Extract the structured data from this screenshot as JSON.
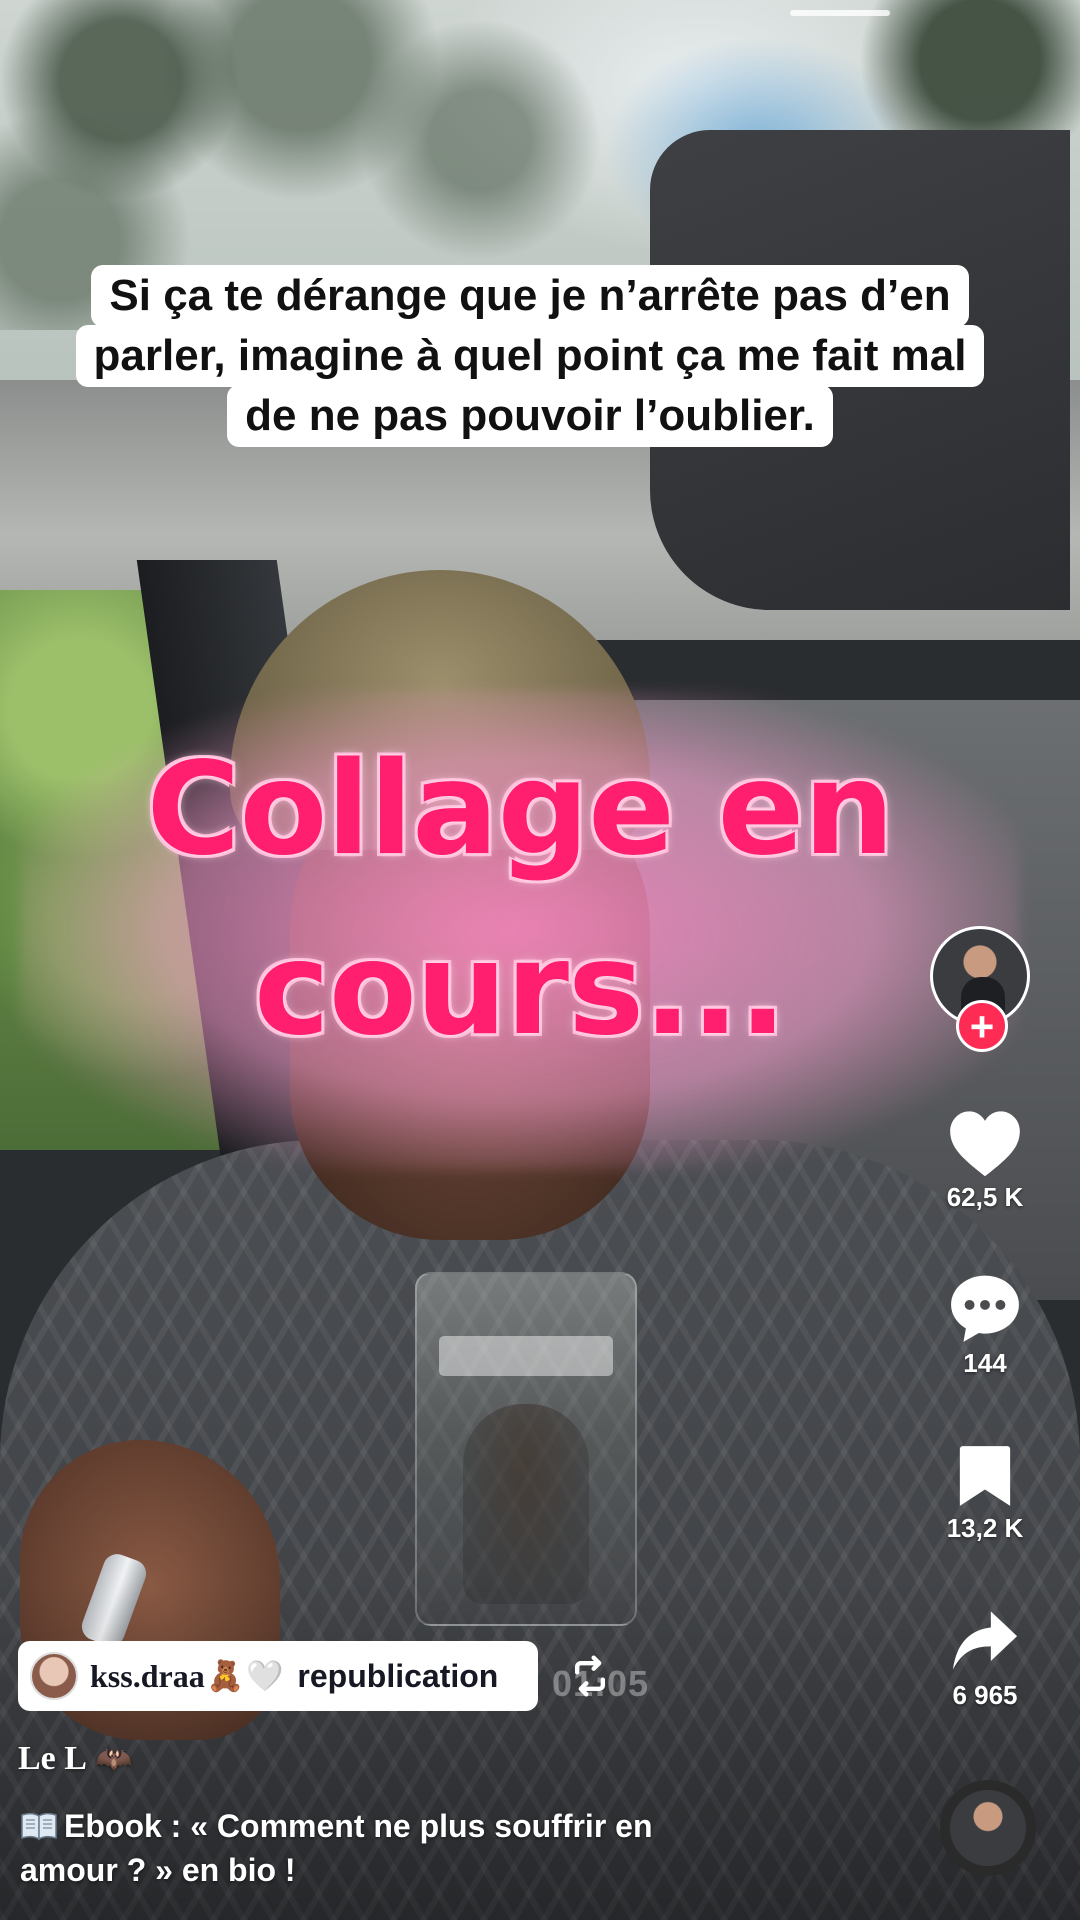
{
  "caption": {
    "lines": [
      "Si ça te dérange que je n’arrête pas d’en",
      "parler, imagine à quel point ça me fait mal",
      "de ne pas pouvoir l’oublier."
    ]
  },
  "collage": {
    "line1": "Collage en",
    "line2": "cours..."
  },
  "actions": {
    "likes": "62,5 K",
    "comments": "144",
    "saves": "13,2 K",
    "shares": "6 965"
  },
  "repost": {
    "username": "kss.draa",
    "emoji": "🧸",
    "heart": "🤍",
    "label": "republication",
    "timer": "01:05"
  },
  "video": {
    "author": "Le L",
    "author_emoji": "🦇",
    "description_line1": "Ebook : « Comment ne plus souffrir en",
    "description_line2": "amour ? » en bio !"
  },
  "colors": {
    "accent_pink": "#ff1f6e",
    "follow_red": "#fe2c55"
  },
  "icons": [
    "heart-icon",
    "comment-icon",
    "bookmark-icon",
    "share-icon",
    "repeat-icon",
    "book-icon",
    "plus-icon"
  ]
}
